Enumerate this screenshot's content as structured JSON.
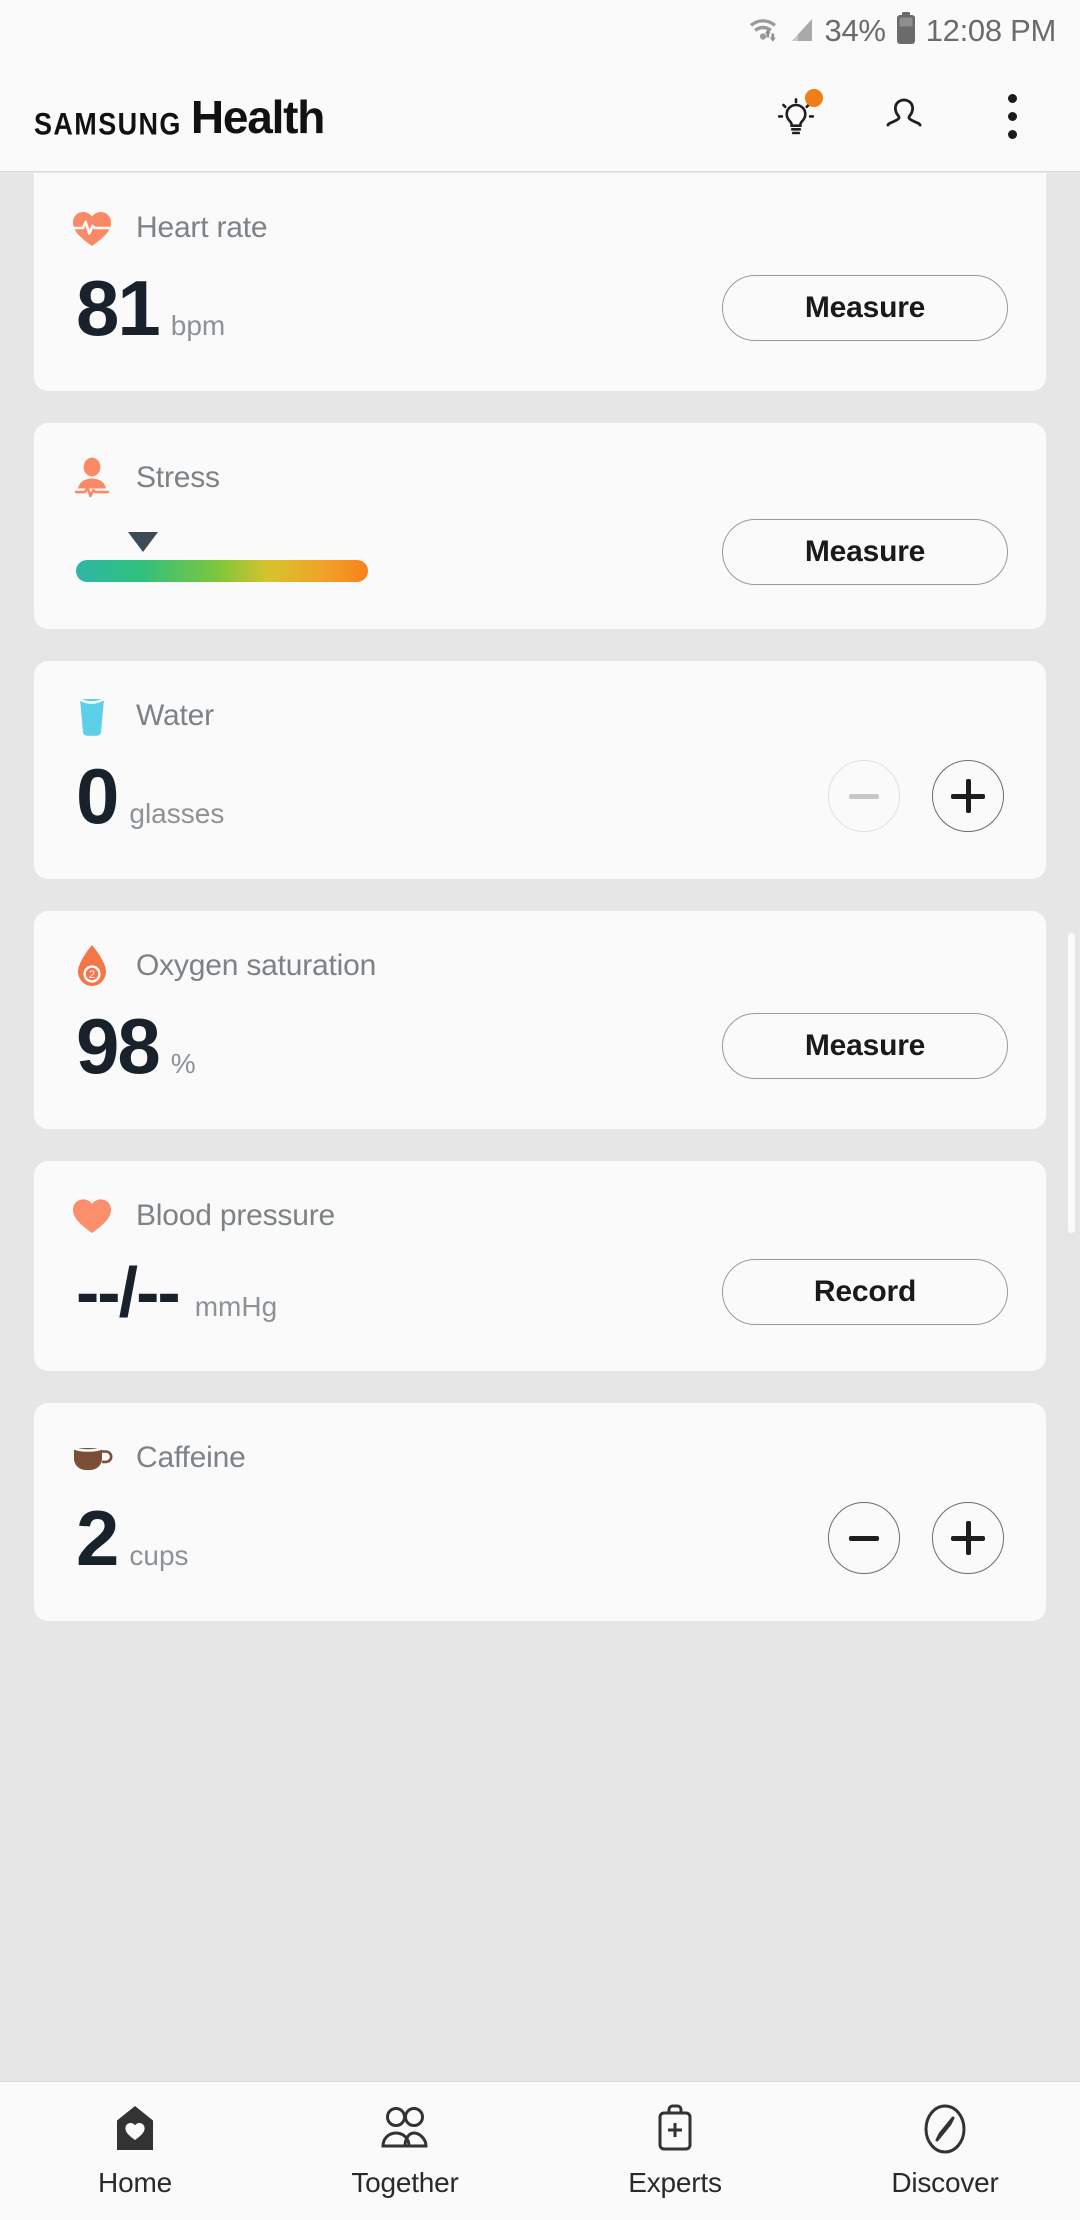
{
  "status_bar": {
    "battery_percent": "34%",
    "time": "12:08 PM",
    "wifi_icon": "wifi-data-icon",
    "signal_icon": "cellular-signal-icon",
    "battery_icon": "battery-icon"
  },
  "app_bar": {
    "brand_prefix": "SAMSUNG",
    "brand_name": "Health",
    "tips_icon": "lightbulb-icon",
    "profile_icon": "profile-icon",
    "more_icon": "kebab-menu-icon",
    "badge_color": "#f07d1a"
  },
  "cards": [
    {
      "id": "heart-rate",
      "title": "Heart rate",
      "icon": "heart-pulse-icon",
      "icon_color": "#fa8a66",
      "value": "81",
      "unit": "bpm",
      "action_label": "Measure",
      "action_type": "button"
    },
    {
      "id": "stress",
      "title": "Stress",
      "icon": "stress-person-icon",
      "icon_color": "#fa8a66",
      "action_label": "Measure",
      "action_type": "button",
      "gauge": {
        "marker_position_percent": 30,
        "gradient_from": "#2fb6a8",
        "gradient_to": "#f7821b"
      }
    },
    {
      "id": "water",
      "title": "Water",
      "icon": "water-glass-icon",
      "icon_color": "#5cd0e8",
      "value": "0",
      "unit": "glasses",
      "action_type": "stepper",
      "decrement_label": "−",
      "increment_label": "+",
      "decrement_enabled": false,
      "increment_enabled": true
    },
    {
      "id": "oxygen-saturation",
      "title": "Oxygen saturation",
      "icon": "oxygen-drop-icon",
      "icon_color": "#f4774a",
      "value": "98",
      "unit": "%",
      "action_label": "Measure",
      "action_type": "button"
    },
    {
      "id": "blood-pressure",
      "title": "Blood pressure",
      "icon": "heart-icon",
      "icon_color": "#fb8f6b",
      "value": "--/--",
      "unit": "mmHg",
      "action_label": "Record",
      "action_type": "button"
    },
    {
      "id": "caffeine",
      "title": "Caffeine",
      "icon": "coffee-cup-icon",
      "icon_color": "#7b4f37",
      "value": "2",
      "unit": "cups",
      "action_type": "stepper",
      "decrement_label": "−",
      "increment_label": "+",
      "decrement_enabled": true,
      "increment_enabled": true
    }
  ],
  "bottom_nav": {
    "items": [
      {
        "label": "Home",
        "icon": "home-heart-icon",
        "active": true
      },
      {
        "label": "Together",
        "icon": "people-icon",
        "active": false
      },
      {
        "label": "Experts",
        "icon": "medical-bag-icon",
        "active": false
      },
      {
        "label": "Discover",
        "icon": "compass-icon",
        "active": false
      }
    ]
  }
}
